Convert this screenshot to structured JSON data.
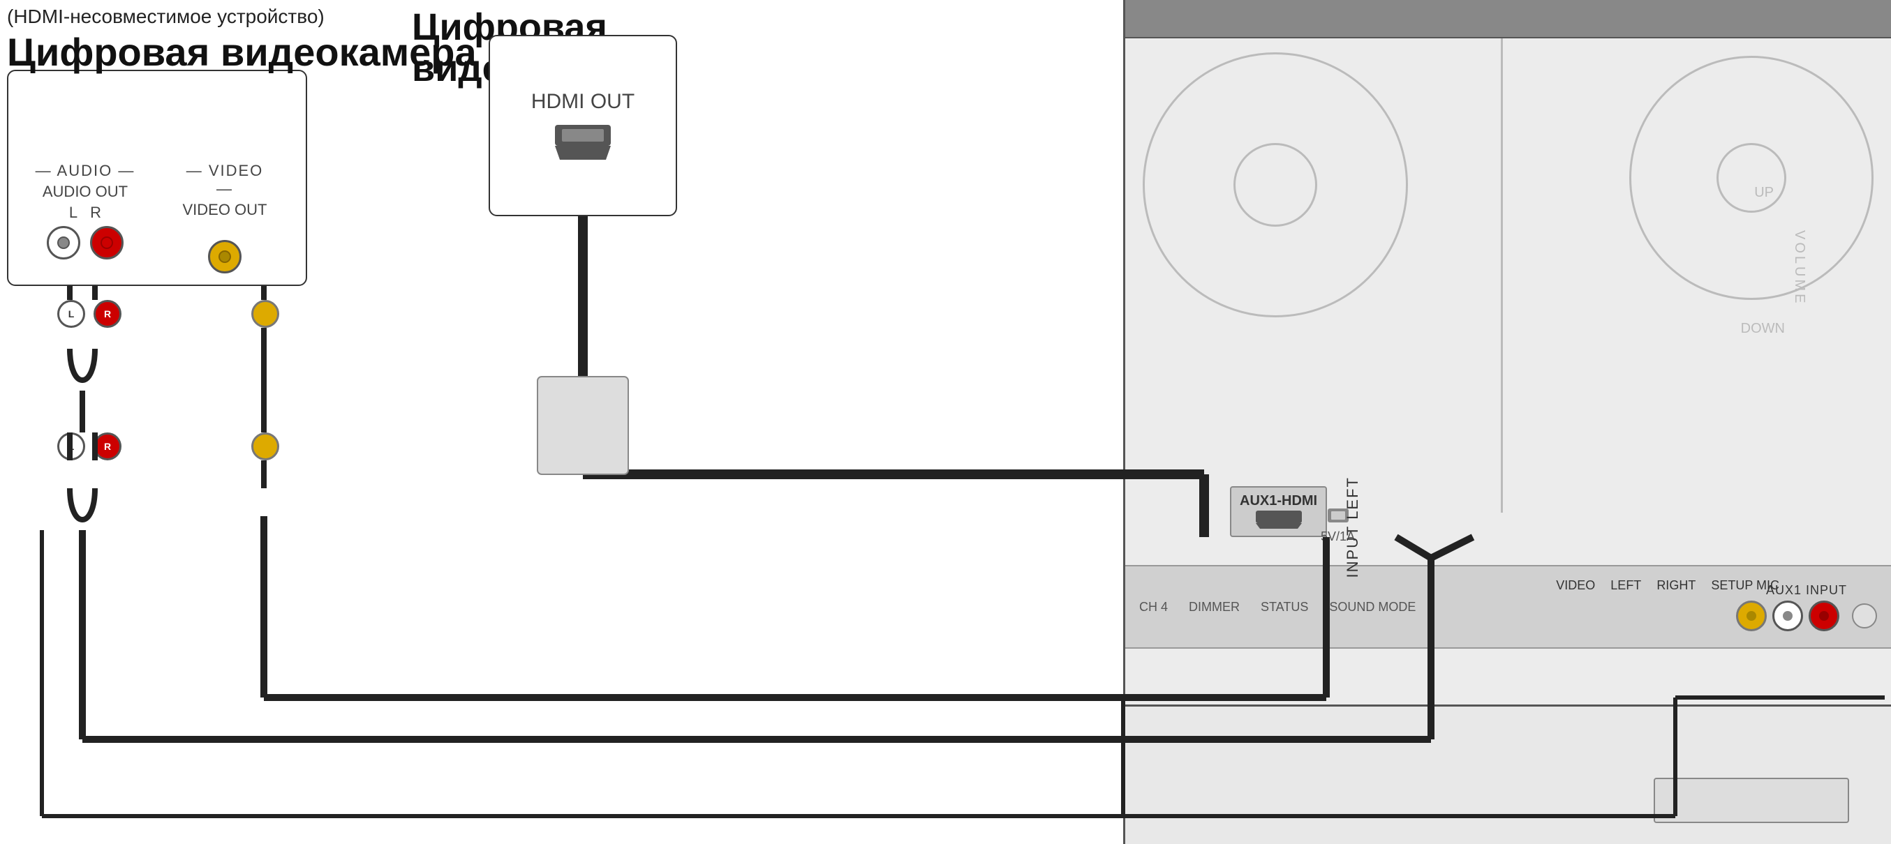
{
  "analog_camera": {
    "subtitle": "(HDMI-несовместимое устройство)",
    "title": "Цифровая видеокамера",
    "audio_section": {
      "dashes_left": "— AUDIO —",
      "out_label": "AUDIO OUT",
      "l_label": "L",
      "r_label": "R"
    },
    "video_section": {
      "dashes_left": "— VIDEO —",
      "out_label": "VIDEO OUT"
    }
  },
  "digital_camera": {
    "title": "Цифровая видеокамера",
    "hdmi_out": "HDMI OUT"
  },
  "device": {
    "aux1_input_label": "AUX1 INPUT",
    "aux1_hdmi_label": "AUX1-HDMI",
    "video_label": "VIDEO",
    "left_label": "LEFT",
    "right_label": "RIGHT",
    "setup_mic_label": "SETUP MIC",
    "volume_label": "VOLUME",
    "up_label": "UP",
    "down_label": "DOWN",
    "ch4_label": "CH 4",
    "dimmer_label": "DIMMER",
    "status_label": "STATUS",
    "sound_mode_label": "SOUND MODE",
    "usb_label": "5V/1A"
  },
  "input_left_text": "INPUT LEFT",
  "cables": {
    "audio_cable_color": "#222",
    "video_cable_color": "#222",
    "hdmi_cable_color": "#222"
  }
}
